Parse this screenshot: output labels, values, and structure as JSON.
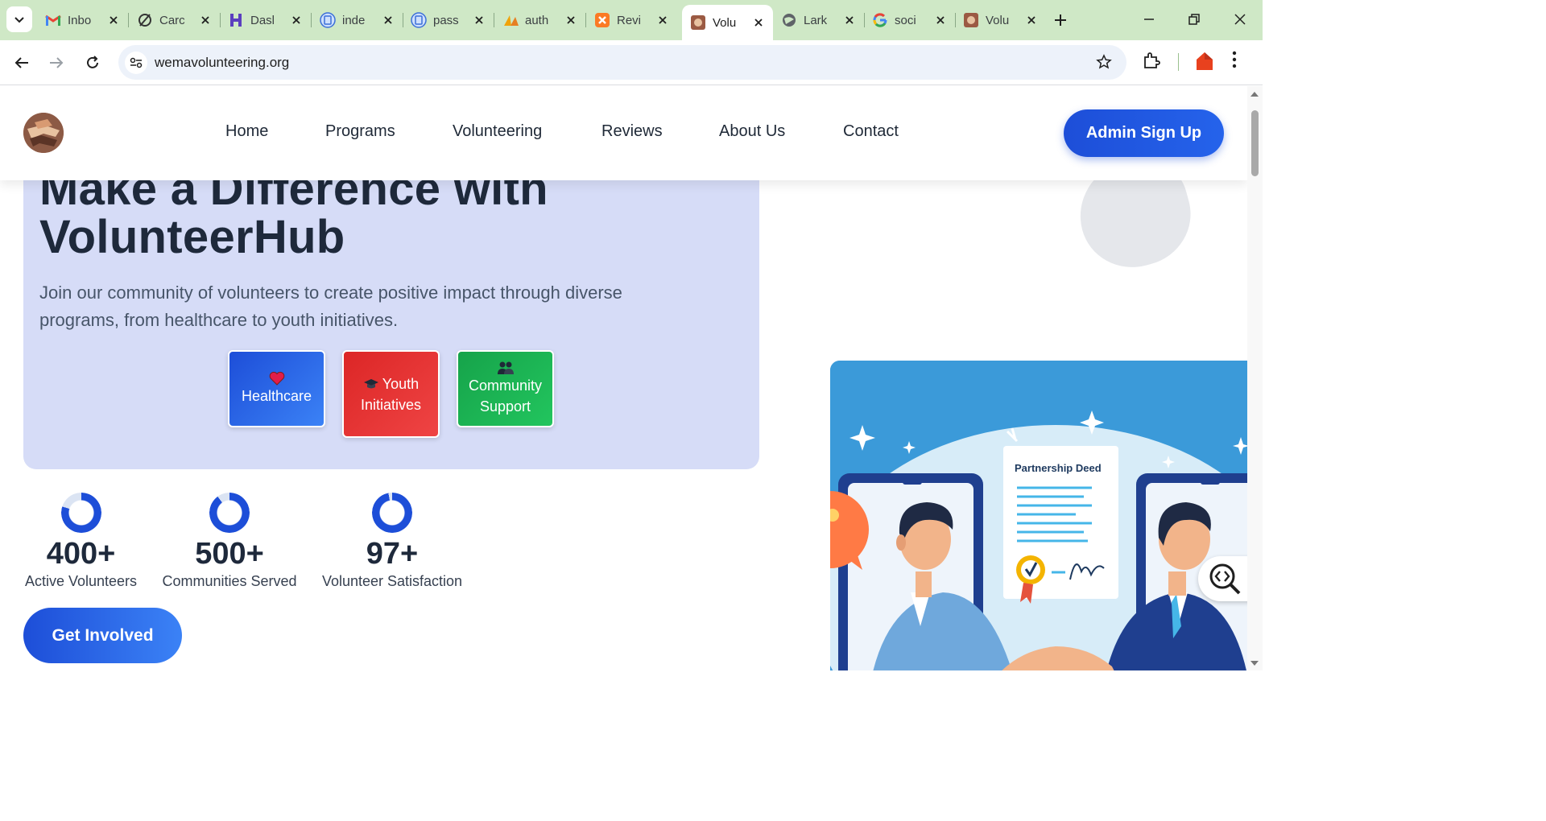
{
  "browser": {
    "tabs": [
      {
        "label": "Inbo",
        "icon": "gmail-icon"
      },
      {
        "label": "Carc",
        "icon": "carbon-icon"
      },
      {
        "label": "Dasl",
        "icon": "dashboard-icon"
      },
      {
        "label": "inde",
        "icon": "document-icon"
      },
      {
        "label": "pass",
        "icon": "document-icon"
      },
      {
        "label": "auth",
        "icon": "pma-icon"
      },
      {
        "label": "Revi",
        "icon": "xampp-icon"
      },
      {
        "label": "Volu",
        "icon": "volunteer-favicon",
        "active": true
      },
      {
        "label": "Lark",
        "icon": "globe-icon"
      },
      {
        "label": "soci",
        "icon": "google-icon"
      },
      {
        "label": "Volu",
        "icon": "volunteer-favicon"
      }
    ],
    "url": "wemavolunteering.org"
  },
  "site": {
    "nav": [
      "Home",
      "Programs",
      "Volunteering",
      "Reviews",
      "About Us",
      "Contact"
    ],
    "admin_button": "Admin Sign Up"
  },
  "hero": {
    "title_line1": "Make a Difference with",
    "title_line2": "VolunteerHub",
    "subtitle": "Join our community of volunteers to create positive impact through diverse programs, from healthcare to youth initiatives.",
    "programs": [
      {
        "label": "Healthcare",
        "icon": "heart-icon",
        "color": "#2563eb"
      },
      {
        "label": "Youth Initiatives",
        "icon": "graduation-cap-icon",
        "color": "#dc2626"
      },
      {
        "label": "Community Support",
        "icon": "people-icon",
        "color": "#16a34a"
      }
    ]
  },
  "stats": [
    {
      "value": "400+",
      "label": "Active Volunteers",
      "progress": 0.8
    },
    {
      "value": "500+",
      "label": "Communities Served",
      "progress": 0.9
    },
    {
      "value": "97+",
      "label": "Volunteer Satisfaction",
      "progress": 0.97
    }
  ],
  "cta": {
    "get_involved": "Get Involved"
  },
  "illustration": {
    "deed_title": "Partnership Deed"
  },
  "colors": {
    "accent": "#1d4ed8",
    "hero_bg": "#d6dcf7",
    "tab_bar": "#cfe8c6"
  }
}
